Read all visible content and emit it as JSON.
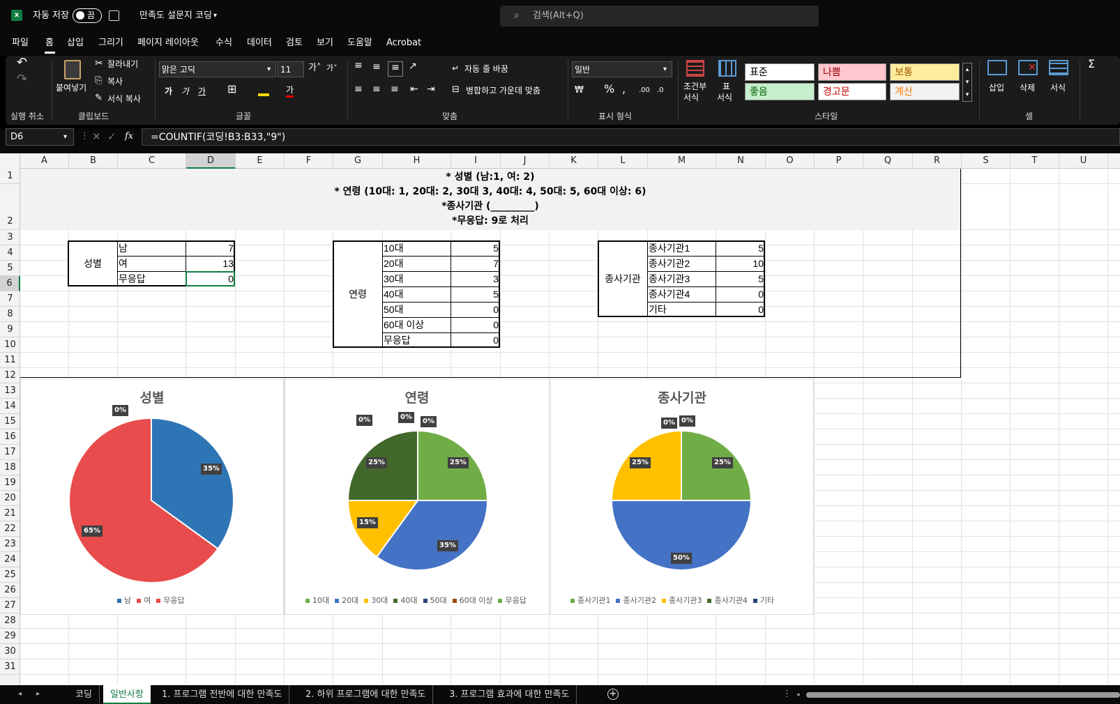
{
  "titlebar": {
    "autosave_label": "자동 저장",
    "toggle_label": "끔",
    "doc_title": "만족도 설문지 코딩",
    "search_placeholder": "검색(Alt+Q)"
  },
  "menu": [
    "파일",
    "홈",
    "삽입",
    "그리기",
    "페이지 레이아웃",
    "수식",
    "데이터",
    "검토",
    "보기",
    "도움말",
    "Acrobat"
  ],
  "ribbon": {
    "undo_group": "실행 취소",
    "clipboard": {
      "paste": "붙여넣기",
      "cut": "잘라내기",
      "copy": "복사",
      "format_painter": "서식 복사",
      "group": "클립보드"
    },
    "font": {
      "name": "맑은 고딕",
      "size": "11",
      "group": "글꼴"
    },
    "align": {
      "wrap": "자동 줄 바꿈",
      "merge": "병합하고 가운데 맞춤",
      "group": "맞춤"
    },
    "number": {
      "format": "일반",
      "group": "표시 형식"
    },
    "styles": {
      "cond1": "조건부",
      "cond2": "서식",
      "table1": "표",
      "table2": "서식",
      "normal": "표준",
      "bad": "나쁨",
      "neutral": "보통",
      "good": "좋음",
      "warning": "경고문",
      "calc": "계산",
      "group": "스타일"
    },
    "cells": {
      "insert": "삽입",
      "delete": "삭제",
      "format": "서식",
      "group": "셀"
    }
  },
  "formula": {
    "name_box": "D6",
    "fx": "fx",
    "content": "=COUNTIF(코딩!B3:B33,\"9\")"
  },
  "columns": [
    "A",
    "B",
    "C",
    "D",
    "E",
    "F",
    "G",
    "H",
    "I",
    "J",
    "K",
    "L",
    "M",
    "N",
    "O",
    "P",
    "Q",
    "R",
    "S",
    "T",
    "U"
  ],
  "rows": [
    "1",
    "2",
    "3",
    "4",
    "5",
    "6",
    "7",
    "8",
    "9",
    "10",
    "11",
    "12",
    "13",
    "14",
    "15",
    "16",
    "17",
    "18",
    "19",
    "20",
    "21",
    "22",
    "23",
    "24",
    "25",
    "26",
    "27",
    "28",
    "29",
    "30",
    "31"
  ],
  "header_lines": [
    "* 성별 (남:1, 여: 2)",
    "* 연령 (10대: 1, 20대: 2, 30대 3, 40대: 4, 50대: 5, 60대 이상: 6)",
    "*종사기관 (_________)",
    "*무응답: 9로 처리"
  ],
  "tables": {
    "gender": {
      "label": "성별",
      "rows": [
        [
          "남",
          "7"
        ],
        [
          "여",
          "13"
        ],
        [
          "무응답",
          "0"
        ]
      ]
    },
    "age": {
      "label": "연령",
      "rows": [
        [
          "10대",
          "5"
        ],
        [
          "20대",
          "7"
        ],
        [
          "30대",
          "3"
        ],
        [
          "40대",
          "5"
        ],
        [
          "50대",
          "0"
        ],
        [
          "60대 이상",
          "0"
        ],
        [
          "무응답",
          "0"
        ]
      ]
    },
    "org": {
      "label": "종사기관",
      "rows": [
        [
          "종사기관1",
          "5"
        ],
        [
          "종사기관2",
          "10"
        ],
        [
          "종사기관3",
          "5"
        ],
        [
          "종사기관4",
          "0"
        ],
        [
          "기타",
          "0"
        ]
      ]
    }
  },
  "chart_data": [
    {
      "type": "pie",
      "title": "성별",
      "categories": [
        "남",
        "여",
        "무응답"
      ],
      "values": [
        7,
        13,
        0
      ],
      "labels": [
        "35%",
        "65%",
        "0%"
      ],
      "colors": [
        "#2e75b6",
        "#e84c4c",
        "#e84c4c"
      ],
      "legend": "bottom"
    },
    {
      "type": "pie",
      "title": "연령",
      "categories": [
        "10대",
        "20대",
        "30대",
        "40대",
        "50대",
        "60대 이상",
        "무응답"
      ],
      "values": [
        5,
        7,
        3,
        5,
        0,
        0,
        0
      ],
      "labels": [
        "25%",
        "35%",
        "15%",
        "25%",
        "0%",
        "0%",
        "0%"
      ],
      "colors": [
        "#70ad47",
        "#4472c4",
        "#ffc000",
        "#43682b",
        "#264478",
        "#9e480e",
        "#70ad47"
      ],
      "legend": "bottom"
    },
    {
      "type": "pie",
      "title": "종사기관",
      "categories": [
        "종사기관1",
        "종사기관2",
        "종사기관3",
        "종사기관4",
        "기타"
      ],
      "values": [
        5,
        10,
        5,
        0,
        0
      ],
      "labels": [
        "25%",
        "50%",
        "25%",
        "0%",
        "0%"
      ],
      "colors": [
        "#70ad47",
        "#4472c4",
        "#ffc000",
        "#43682b",
        "#264478"
      ],
      "legend": "bottom"
    }
  ],
  "sheet_tabs": [
    "코딩",
    "일반사항",
    "1. 프로그램 전반에 대한 만족도",
    "2. 하위 프로그램에 대한 만족도",
    "3. 프로그램 효과에 대한 만족도"
  ],
  "active_tab": "일반사항"
}
